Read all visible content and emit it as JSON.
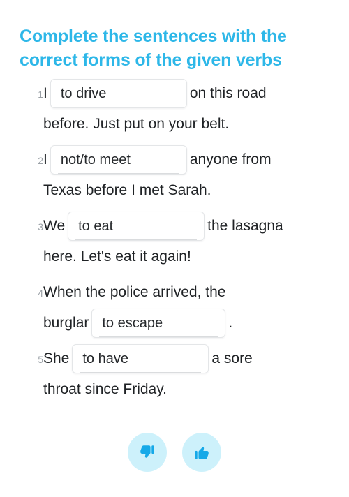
{
  "title": "Complete the sentences with the correct forms of the given verbs",
  "colors": {
    "title": "#2db7e8",
    "body_text": "#1f2225",
    "number": "#9aa0a6",
    "input_border": "#e4e6e8",
    "input_background": "#ffffff",
    "button_background": "#cdf1fb",
    "button_icon": "#16a9e8",
    "page_background": "#ffffff"
  },
  "questions": [
    {
      "number": "1",
      "before": "I",
      "answer": "to drive",
      "after": "on this road",
      "continuation": "before. Just put on your belt."
    },
    {
      "number": "2",
      "before": "I",
      "answer": "not/to meet",
      "after": "anyone from",
      "continuation": "Texas before I met Sarah."
    },
    {
      "number": "3",
      "before": "We",
      "answer": "to eat",
      "after": "the lasagna",
      "continuation": "here. Let's eat it again!"
    },
    {
      "number": "4",
      "before": "When the police arrived, the",
      "before2": "burglar",
      "answer": "to escape",
      "after": ".",
      "continuation": ""
    },
    {
      "number": "5",
      "before": "She",
      "answer": "to have",
      "after": "a sore",
      "continuation": "throat since Friday."
    }
  ],
  "feedback": {
    "dislike_label": "thumbs-down",
    "like_label": "thumbs-up"
  }
}
